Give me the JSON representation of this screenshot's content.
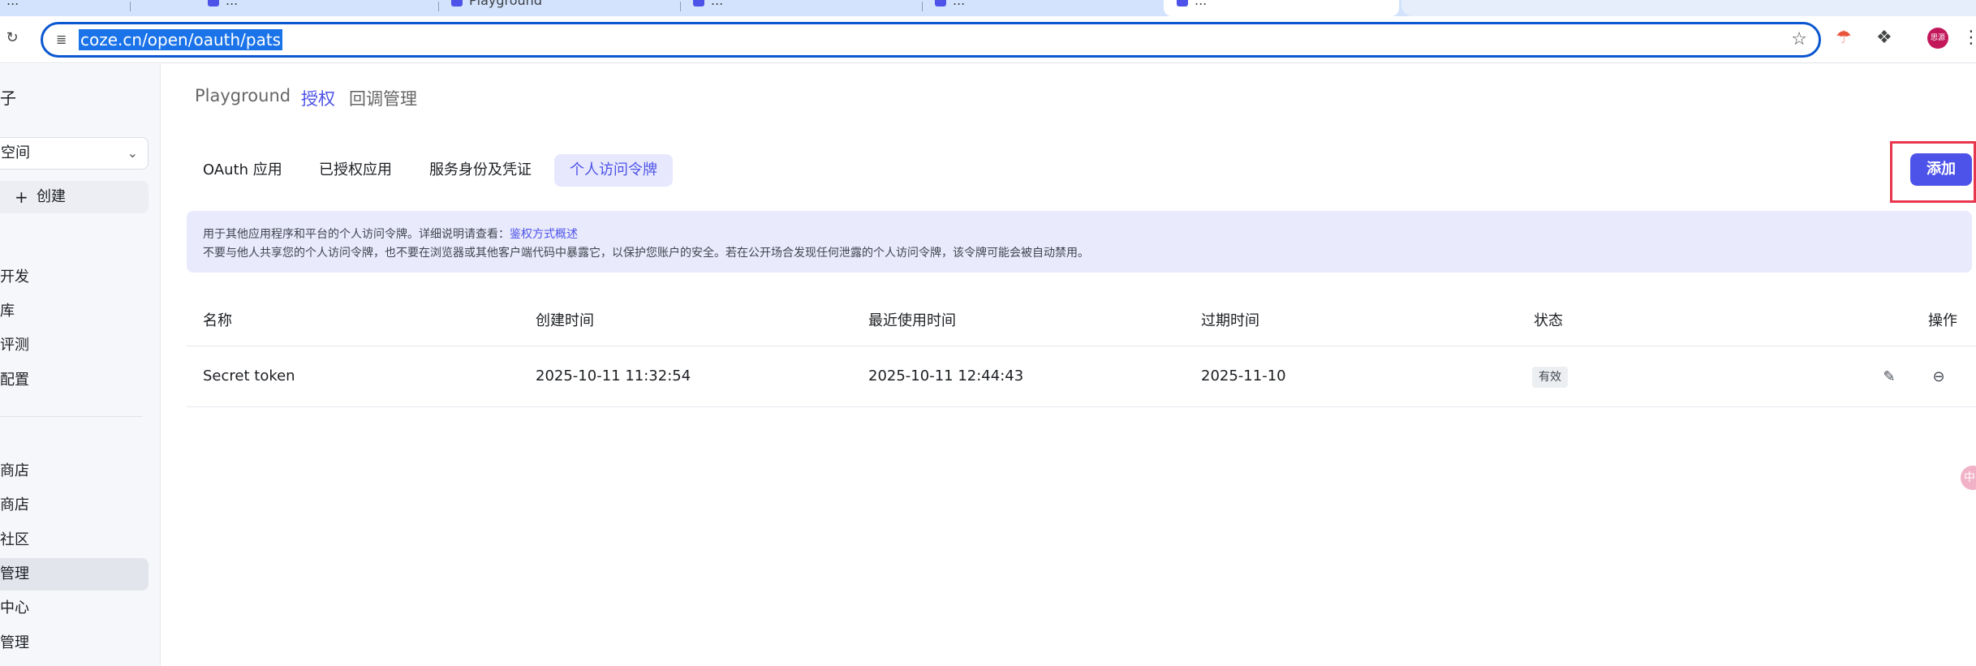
{
  "browser": {
    "tabs": [
      {
        "label": "...",
        "active": false
      },
      {
        "label": "...",
        "active": false
      },
      {
        "label": "Playground",
        "active": false
      },
      {
        "label": "...",
        "active": false
      },
      {
        "label": "...",
        "active": false
      },
      {
        "label": "...",
        "active": true
      }
    ],
    "url": "coze.cn/open/oauth/pats",
    "profile_label": "思源"
  },
  "sidebar": {
    "top_label": "子",
    "space_label": "空间",
    "create_label": "创建",
    "items": [
      {
        "label": "开发",
        "active": false
      },
      {
        "label": "库",
        "active": false
      },
      {
        "label": "评测",
        "active": false
      },
      {
        "label": "配置",
        "active": false
      },
      {
        "label": "商店",
        "active": false
      },
      {
        "label": "商店",
        "active": false
      },
      {
        "label": "社区",
        "active": false
      },
      {
        "label": "管理",
        "active": true
      },
      {
        "label": "中心",
        "active": false
      },
      {
        "label": "管理",
        "active": false
      }
    ]
  },
  "top_nav": {
    "items": [
      "Playground",
      "授权",
      "回调管理"
    ],
    "active": "授权"
  },
  "sub_tabs": {
    "items": [
      "OAuth 应用",
      "已授权应用",
      "服务身份及凭证",
      "个人访问令牌"
    ],
    "active": "个人访问令牌"
  },
  "add_button": "添加",
  "notice": {
    "line1_prefix": "用于其他应用程序和平台的个人访问令牌。详细说明请查看：",
    "line1_link": "鉴权方式概述",
    "line2": "不要与他人共享您的个人访问令牌，也不要在浏览器或其他客户端代码中暴露它，以保护您账户的安全。若在公开场合发现任何泄露的个人访问令牌，该令牌可能会被自动禁用。"
  },
  "table": {
    "headers": {
      "name": "名称",
      "created": "创建时间",
      "last_used": "最近使用时间",
      "expires": "过期时间",
      "status": "状态",
      "actions": "操作"
    },
    "rows": [
      {
        "name": "Secret token",
        "created": "2025-10-11 11:32:54",
        "last_used": "2025-10-11 12:44:43",
        "expires": "2025-11-10",
        "status": "有效"
      }
    ]
  },
  "float_widget": "中",
  "icons": {
    "reload": "reload-icon",
    "site_settings": "tune-icon",
    "bookmark": "star-icon",
    "extension_1": "translate-icon",
    "extension_2": "puzzle-icon",
    "menu": "kebab-icon",
    "edit": "edit-icon",
    "delete": "minus-circle-icon"
  },
  "colors": {
    "accent": "#4d53e8",
    "highlight_box": "#e8364d",
    "notice_bg": "#e9eafc"
  }
}
